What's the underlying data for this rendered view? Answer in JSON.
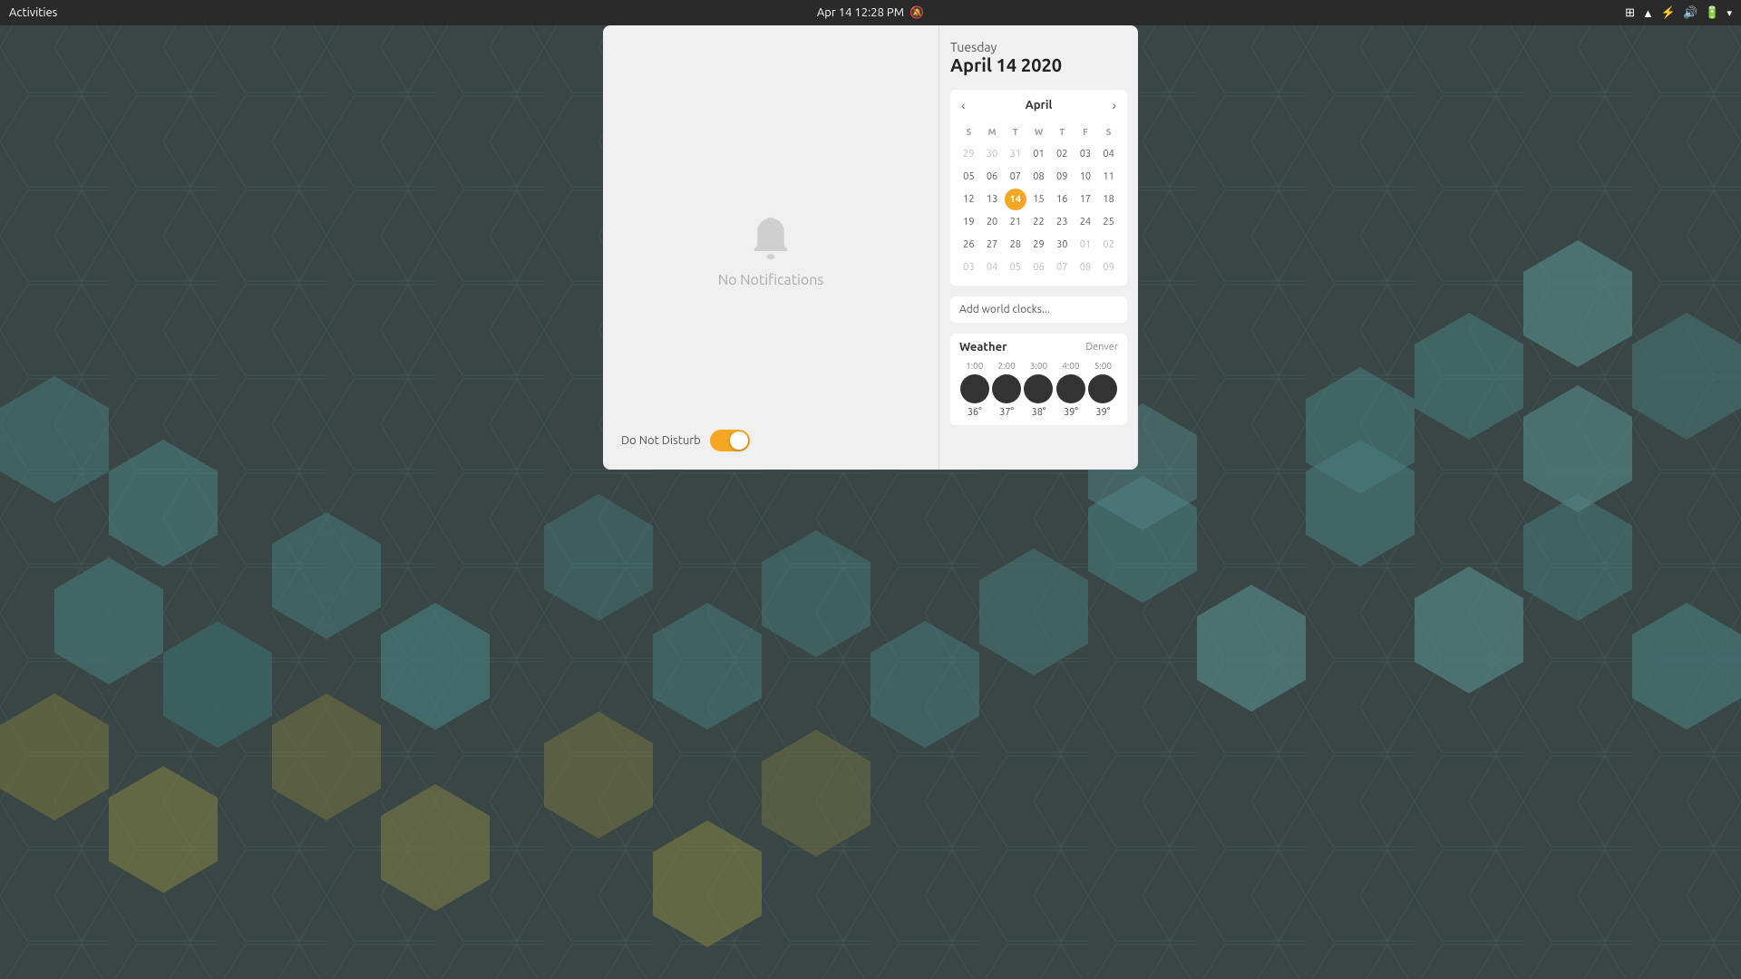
{
  "topbar": {
    "activities_label": "Activities",
    "datetime": "Apr 14  12:28 PM",
    "tray": {
      "icons": [
        "grid-icon",
        "wifi-icon",
        "bluetooth-icon",
        "volume-icon",
        "battery-icon",
        "arrow-icon"
      ]
    }
  },
  "notifications": {
    "empty_icon": "bell-icon",
    "empty_text": "No Notifications",
    "dnd_label": "Do Not Disturb",
    "dnd_enabled": true
  },
  "calendar": {
    "day_name": "Tuesday",
    "date_full": "April 14 2020",
    "month": "April",
    "headers": [
      "S",
      "M",
      "T",
      "W",
      "T",
      "F",
      "S"
    ],
    "weeks": [
      [
        "29",
        "30",
        "31",
        "01",
        "02",
        "03",
        "04"
      ],
      [
        "05",
        "06",
        "07",
        "08",
        "09",
        "10",
        "11"
      ],
      [
        "12",
        "13",
        "14",
        "15",
        "16",
        "17",
        "18"
      ],
      [
        "19",
        "20",
        "21",
        "22",
        "23",
        "24",
        "25"
      ],
      [
        "26",
        "27",
        "28",
        "29",
        "30",
        "01",
        "02"
      ],
      [
        "03",
        "04",
        "05",
        "06",
        "07",
        "08",
        "09"
      ]
    ],
    "today": "14",
    "today_row": 2,
    "today_col": 2,
    "prev_label": "‹",
    "next_label": "›"
  },
  "world_clocks": {
    "add_label": "Add world clocks..."
  },
  "weather": {
    "title": "Weather",
    "location": "Denver",
    "times": [
      "1:00",
      "2:00",
      "3:00",
      "4:00",
      "5:00"
    ],
    "temps": [
      "36°",
      "37°",
      "38°",
      "39°",
      "39°"
    ]
  }
}
